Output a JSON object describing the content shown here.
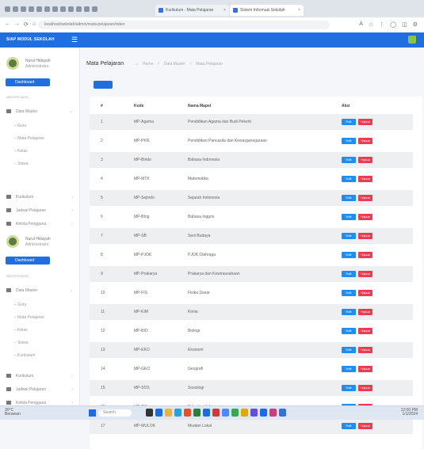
{
  "browser": {
    "tabs": [
      {
        "title": "Kurikulum - Mata Pelajaran",
        "active": false
      },
      {
        "title": "Sistem Informasi Sekolah",
        "active": true
      }
    ],
    "url": "localhost/sekolah/admin/mata-pelajaran/index",
    "nav": {
      "back": "←",
      "forward": "→",
      "reload": "⟳",
      "home": "⌂"
    },
    "tools": [
      "A",
      "☆",
      "⋮",
      "◯",
      "◫",
      "⚙"
    ]
  },
  "topnav": {
    "brand": "SIAP MODUL SEKOLAH",
    "menu_icon": "☰"
  },
  "sidebar": {
    "user": {
      "name": "Nurul Hidayah",
      "role": "Administrator"
    },
    "dashboard": "Dashboard",
    "section": "MASTER DATA",
    "menu": [
      {
        "label": "Data Master",
        "sub": [
          "Guru",
          "Mata Pelajaran",
          "Kelas",
          "Siswa"
        ]
      },
      {
        "label": "Kurikulum"
      },
      {
        "label": "Jadwal Pelajaran"
      },
      {
        "label": "Kelola Pengguna"
      }
    ]
  },
  "page": {
    "title": "Mata Pelajaran",
    "breadcrumb": [
      "Home",
      "Data Master",
      "Mata Pelajaran"
    ]
  },
  "table": {
    "headers": [
      "#",
      "Kode",
      "Nama Mapel",
      "Aksi"
    ],
    "edit_label": "Edit",
    "delete_label": "Hapus",
    "rows": [
      [
        "1",
        "MP-Agama",
        "Pendidikan Agama dan Budi Pekerti"
      ],
      [
        "2",
        "MP-PKN",
        "Pendidikan Pancasila dan Kewarganegaraan"
      ],
      [
        "3",
        "MP-Bindo",
        "Bahasa Indonesia"
      ],
      [
        "4",
        "MP-MTK",
        "Matematika"
      ],
      [
        "5",
        "MP-Sejindo",
        "Sejarah Indonesia"
      ],
      [
        "6",
        "MP-BIng",
        "Bahasa Inggris"
      ],
      [
        "7",
        "MP-SB",
        "Seni Budaya"
      ],
      [
        "8",
        "MP-PJOK",
        "PJOK Olahraga"
      ],
      [
        "9",
        "MP-Prakarya",
        "Prakarya dan Kewirausahaan"
      ],
      [
        "10",
        "MP-FIS",
        "Fisika Dasar"
      ],
      [
        "11",
        "MP-KIM",
        "Kimia"
      ],
      [
        "12",
        "MP-BIO",
        "Biologi"
      ],
      [
        "13",
        "MP-EKO",
        "Ekonomi"
      ],
      [
        "14",
        "MP-GEO",
        "Geografi"
      ],
      [
        "15",
        "MP-SOS",
        "Sosiologi"
      ],
      [
        "16",
        "MP-TIK",
        "Teknologi Informasi"
      ],
      [
        "17",
        "MP-MULOK",
        "Muatan Lokal"
      ]
    ]
  },
  "taskbar": {
    "weather_temp": "30°C",
    "weather_desc": "Berawan",
    "search": "Search",
    "time": "12:00 PM",
    "date": "1/1/2024"
  },
  "colors": {
    "primary": "#1f6fe0",
    "edit": "#1e8ef2",
    "delete": "#ea3c53"
  }
}
